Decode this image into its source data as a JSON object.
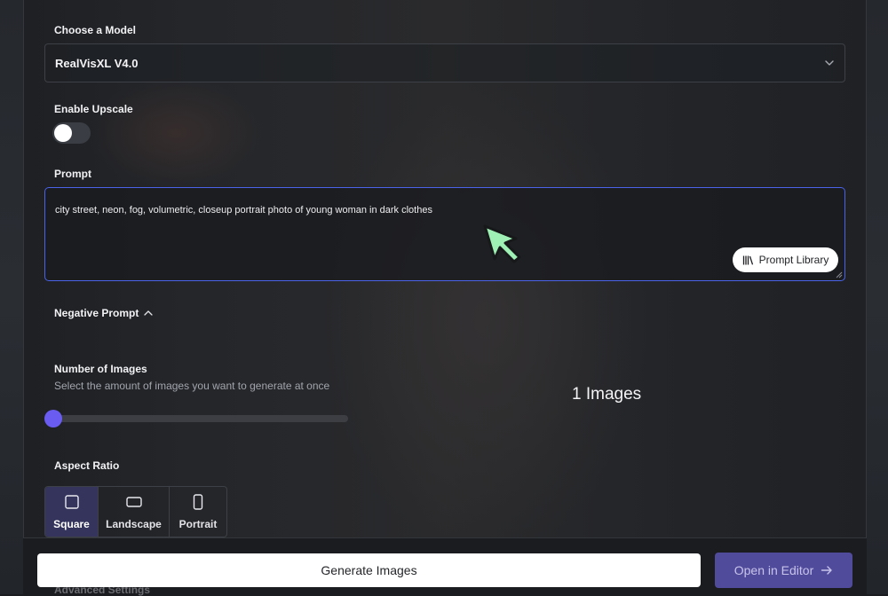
{
  "model": {
    "label": "Choose a Model",
    "selected": "RealVisXL V4.0"
  },
  "upscale": {
    "label": "Enable Upscale",
    "enabled": false
  },
  "prompt": {
    "label": "Prompt",
    "value": "city street, neon, fog, volumetric, closeup portrait photo of young woman in dark clothes",
    "library_button": "Prompt Library"
  },
  "negative_prompt": {
    "label": "Negative Prompt"
  },
  "num_images": {
    "label": "Number of Images",
    "description": "Select the amount of images you want to generate at once",
    "value_text": "1 Images",
    "slider_level": 0
  },
  "aspect_ratio": {
    "label": "Aspect Ratio",
    "options": [
      {
        "label": "Square",
        "icon": "square-icon",
        "active": true
      },
      {
        "label": "Landscape",
        "icon": "landscape-icon",
        "active": false
      },
      {
        "label": "Portrait",
        "icon": "portrait-icon",
        "active": false
      }
    ]
  },
  "advanced": {
    "label": "Advanced Settings"
  },
  "footer": {
    "generate_label": "Generate Images",
    "editor_label": "Open in Editor"
  },
  "colors": {
    "accent": "#6a5cf0",
    "focus_border": "#4a63e8",
    "editor_button": "#514b9c",
    "cursor": "#9ef0b4"
  }
}
